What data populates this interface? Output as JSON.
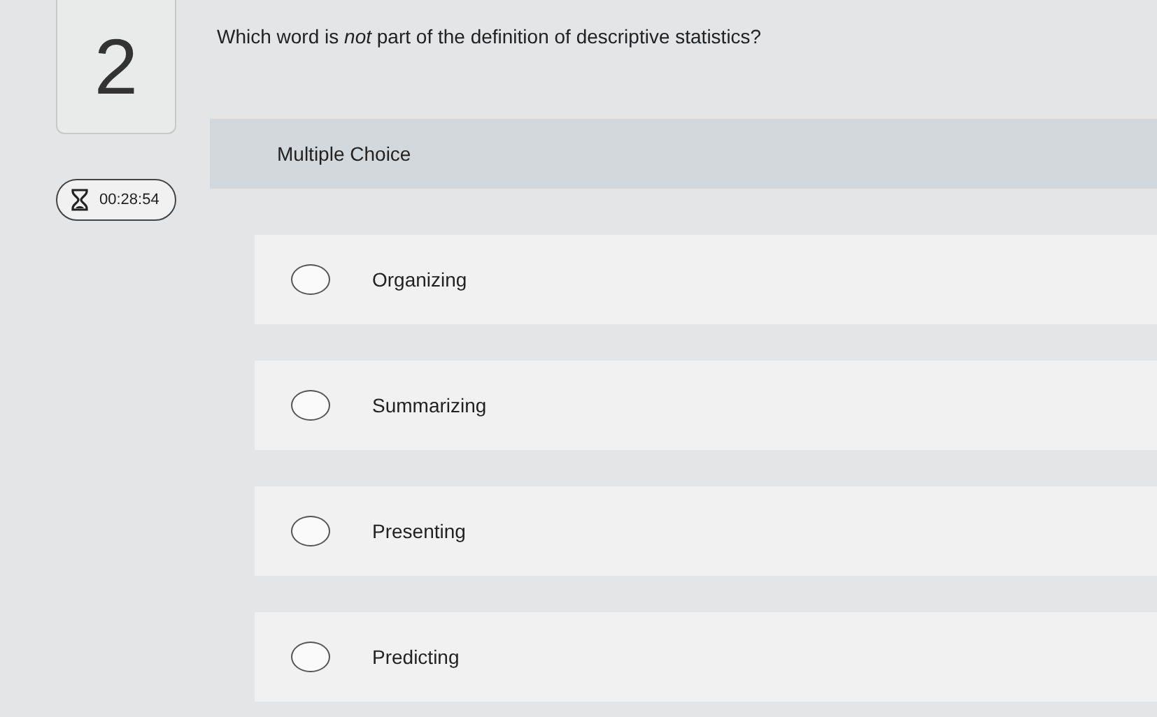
{
  "question_number": "2",
  "timer": {
    "time": "00:28:54"
  },
  "question": {
    "text": "Which word is *not* part of the definition of descriptive statistics?"
  },
  "question_type": "Multiple Choice",
  "options": [
    {
      "label": "Organizing",
      "selected": false
    },
    {
      "label": "Summarizing",
      "selected": false
    },
    {
      "label": "Presenting",
      "selected": false
    },
    {
      "label": "Predicting",
      "selected": false
    }
  ]
}
